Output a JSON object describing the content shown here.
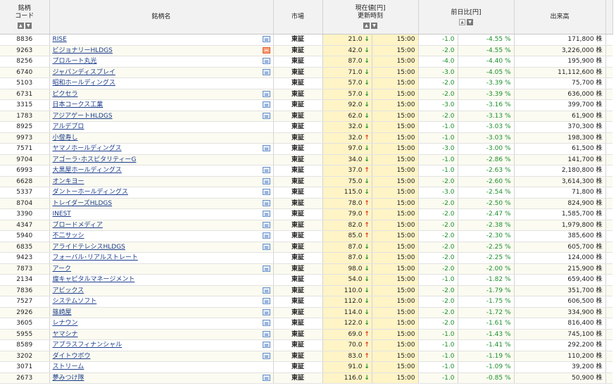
{
  "headers": {
    "code": "銘柄\nコード",
    "name": "銘柄名",
    "market": "市場",
    "price": "現在値[円]",
    "time": "更新時刻",
    "change": "前日比[円]",
    "volume": "出来高"
  },
  "sort_icons": {
    "asc": "▲",
    "desc": "▼"
  },
  "arrows": {
    "down": "↓",
    "up": "↑"
  },
  "rows": [
    {
      "code": "8836",
      "name": "RISE",
      "badge": "blue",
      "market": "東証",
      "price": "21.0",
      "dir": "down",
      "time": "15:00",
      "change": "-1.0",
      "pct": "-4.55 %",
      "volume": "171,800 株"
    },
    {
      "code": "9263",
      "name": "ビジョナリーHLDGS",
      "badge": "red",
      "market": "東証",
      "price": "42.0",
      "dir": "down",
      "time": "15:00",
      "change": "-2.0",
      "pct": "-4.55 %",
      "volume": "3,226,000 株"
    },
    {
      "code": "8256",
      "name": "プロルート丸光",
      "badge": "blue",
      "market": "東証",
      "price": "87.0",
      "dir": "down",
      "time": "15:00",
      "change": "-4.0",
      "pct": "-4.40 %",
      "volume": "195,900 株"
    },
    {
      "code": "6740",
      "name": "ジャパンディスプレイ",
      "badge": "blue",
      "market": "東証",
      "price": "71.0",
      "dir": "down",
      "time": "15:00",
      "change": "-3.0",
      "pct": "-4.05 %",
      "volume": "11,112,600 株"
    },
    {
      "code": "5103",
      "name": "昭和ホールディングス",
      "badge": "",
      "market": "東証",
      "price": "57.0",
      "dir": "down",
      "time": "15:00",
      "change": "-2.0",
      "pct": "-3.39 %",
      "volume": "75,700 株"
    },
    {
      "code": "6731",
      "name": "ピクセラ",
      "badge": "blue",
      "market": "東証",
      "price": "57.0",
      "dir": "down",
      "time": "15:00",
      "change": "-2.0",
      "pct": "-3.39 %",
      "volume": "636,000 株"
    },
    {
      "code": "3315",
      "name": "日本コークス工業",
      "badge": "blue",
      "market": "東証",
      "price": "92.0",
      "dir": "down",
      "time": "15:00",
      "change": "-3.0",
      "pct": "-3.16 %",
      "volume": "399,700 株"
    },
    {
      "code": "1783",
      "name": "アジアゲートHLDGS",
      "badge": "blue",
      "market": "東証",
      "price": "62.0",
      "dir": "down",
      "time": "15:00",
      "change": "-2.0",
      "pct": "-3.13 %",
      "volume": "61,900 株"
    },
    {
      "code": "8925",
      "name": "アルデプロ",
      "badge": "",
      "market": "東証",
      "price": "32.0",
      "dir": "down",
      "time": "15:00",
      "change": "-1.0",
      "pct": "-3.03 %",
      "volume": "370,300 株"
    },
    {
      "code": "9973",
      "name": "小僧寿し",
      "badge": "",
      "market": "東証",
      "price": "32.0",
      "dir": "up",
      "time": "15:00",
      "change": "-1.0",
      "pct": "-3.03 %",
      "volume": "198,300 株"
    },
    {
      "code": "7571",
      "name": "ヤマノホールディングス",
      "badge": "blue",
      "market": "東証",
      "price": "97.0",
      "dir": "down",
      "time": "15:00",
      "change": "-3.0",
      "pct": "-3.00 %",
      "volume": "61,500 株"
    },
    {
      "code": "9704",
      "name": "アゴーラ･ホスピタリティーG",
      "badge": "",
      "market": "東証",
      "price": "34.0",
      "dir": "down",
      "time": "15:00",
      "change": "-1.0",
      "pct": "-2.86 %",
      "volume": "141,700 株"
    },
    {
      "code": "6993",
      "name": "大黒屋ホールディングス",
      "badge": "blue",
      "market": "東証",
      "price": "37.0",
      "dir": "up",
      "time": "15:00",
      "change": "-1.0",
      "pct": "-2.63 %",
      "volume": "2,180,800 株"
    },
    {
      "code": "6628",
      "name": "オンキヨー",
      "badge": "blue",
      "market": "東証",
      "price": "75.0",
      "dir": "down",
      "time": "15:00",
      "change": "-2.0",
      "pct": "-2.60 %",
      "volume": "3,614,300 株"
    },
    {
      "code": "5337",
      "name": "ダントーホールディングス",
      "badge": "blue",
      "market": "東証",
      "price": "115.0",
      "dir": "down",
      "time": "15:00",
      "change": "-3.0",
      "pct": "-2.54 %",
      "volume": "71,800 株"
    },
    {
      "code": "8704",
      "name": "トレイダーズHLDGS",
      "badge": "blue",
      "market": "東証",
      "price": "78.0",
      "dir": "up",
      "time": "15:00",
      "change": "-2.0",
      "pct": "-2.50 %",
      "volume": "824,900 株"
    },
    {
      "code": "3390",
      "name": "INEST",
      "badge": "blue",
      "market": "東証",
      "price": "79.0",
      "dir": "up",
      "time": "15:00",
      "change": "-2.0",
      "pct": "-2.47 %",
      "volume": "1,585,700 株"
    },
    {
      "code": "4347",
      "name": "ブロードメディア",
      "badge": "blue",
      "market": "東証",
      "price": "82.0",
      "dir": "up",
      "time": "15:00",
      "change": "-2.0",
      "pct": "-2.38 %",
      "volume": "1,979,800 株"
    },
    {
      "code": "5940",
      "name": "不二サッシ",
      "badge": "blue",
      "market": "東証",
      "price": "85.0",
      "dir": "up",
      "time": "15:00",
      "change": "-2.0",
      "pct": "-2.30 %",
      "volume": "385,600 株"
    },
    {
      "code": "6835",
      "name": "アライドテレシスHLDGS",
      "badge": "blue",
      "market": "東証",
      "price": "87.0",
      "dir": "down",
      "time": "15:00",
      "change": "-2.0",
      "pct": "-2.25 %",
      "volume": "605,700 株"
    },
    {
      "code": "9423",
      "name": "フォーバル･リアルストレート",
      "badge": "",
      "market": "東証",
      "price": "87.0",
      "dir": "down",
      "time": "15:00",
      "change": "-2.0",
      "pct": "-2.25 %",
      "volume": "124,000 株"
    },
    {
      "code": "7873",
      "name": "アーク",
      "badge": "blue",
      "market": "東証",
      "price": "98.0",
      "dir": "down",
      "time": "15:00",
      "change": "-2.0",
      "pct": "-2.00 %",
      "volume": "215,900 株"
    },
    {
      "code": "2134",
      "name": "燦キャピタルマネージメント",
      "badge": "",
      "market": "東証",
      "price": "54.0",
      "dir": "down",
      "time": "15:00",
      "change": "-1.0",
      "pct": "-1.82 %",
      "volume": "659,400 株"
    },
    {
      "code": "7836",
      "name": "アビックス",
      "badge": "blue",
      "market": "東証",
      "price": "110.0",
      "dir": "down",
      "time": "15:00",
      "change": "-2.0",
      "pct": "-1.79 %",
      "volume": "351,700 株"
    },
    {
      "code": "7527",
      "name": "システムソフト",
      "badge": "blue",
      "market": "東証",
      "price": "112.0",
      "dir": "down",
      "time": "15:00",
      "change": "-2.0",
      "pct": "-1.75 %",
      "volume": "606,500 株"
    },
    {
      "code": "2926",
      "name": "篠崎屋",
      "badge": "blue",
      "market": "東証",
      "price": "114.0",
      "dir": "down",
      "time": "15:00",
      "change": "-2.0",
      "pct": "-1.72 %",
      "volume": "334,900 株"
    },
    {
      "code": "3605",
      "name": "レナウン",
      "badge": "blue",
      "market": "東証",
      "price": "122.0",
      "dir": "down",
      "time": "15:00",
      "change": "-2.0",
      "pct": "-1.61 %",
      "volume": "816,400 株"
    },
    {
      "code": "5955",
      "name": "ヤマシナ",
      "badge": "blue",
      "market": "東証",
      "price": "69.0",
      "dir": "up",
      "time": "15:00",
      "change": "-1.0",
      "pct": "-1.43 %",
      "volume": "745,100 株"
    },
    {
      "code": "8589",
      "name": "アプラスフィナンシャル",
      "badge": "blue",
      "market": "東証",
      "price": "70.0",
      "dir": "up",
      "time": "15:00",
      "change": "-1.0",
      "pct": "-1.41 %",
      "volume": "292,200 株"
    },
    {
      "code": "3202",
      "name": "ダイトウボウ",
      "badge": "blue",
      "market": "東証",
      "price": "83.0",
      "dir": "up",
      "time": "15:00",
      "change": "-1.0",
      "pct": "-1.19 %",
      "volume": "110,200 株"
    },
    {
      "code": "3071",
      "name": "ストリーム",
      "badge": "",
      "market": "東証",
      "price": "91.0",
      "dir": "down",
      "time": "15:00",
      "change": "-1.0",
      "pct": "-1.09 %",
      "volume": "39,200 株"
    },
    {
      "code": "2673",
      "name": "夢みつけ隊",
      "badge": "blue",
      "market": "東証",
      "price": "116.0",
      "dir": "down",
      "time": "15:00",
      "change": "-1.0",
      "pct": "-0.85 %",
      "volume": "50,900 株"
    }
  ]
}
